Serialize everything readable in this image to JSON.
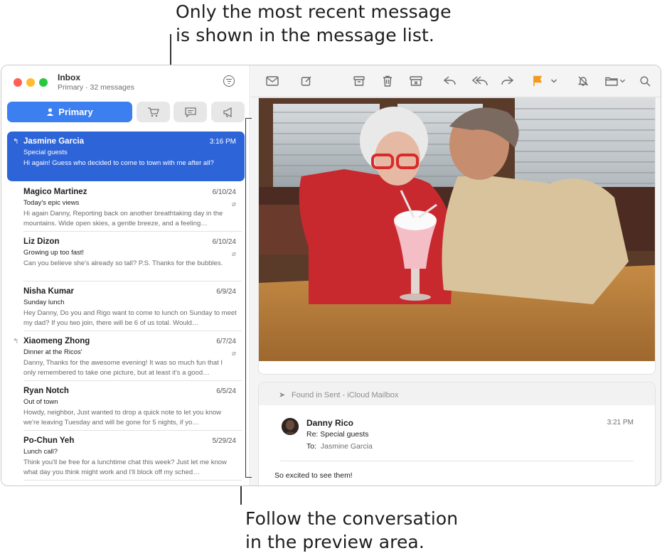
{
  "callouts": {
    "top": [
      "Only the most recent message",
      "is shown in the message list."
    ],
    "bottom": [
      "Follow the conversation",
      "in the preview area."
    ]
  },
  "sidebar": {
    "title": "Inbox",
    "subtitle": "Primary · 32 messages",
    "primary_tab": "Primary",
    "category_icons": [
      "cart-icon",
      "chat-bubble-icon",
      "megaphone-icon"
    ]
  },
  "messages": [
    {
      "from": "Jasmine Garcia",
      "date": "3:16 PM",
      "subject": "Special guests",
      "preview": "Hi again! Guess who decided to come to town with me after all?",
      "selected": true,
      "replied": true,
      "attachment": false
    },
    {
      "from": "Magico Martinez",
      "date": "6/10/24",
      "subject": "Today's epic views",
      "preview": "Hi again Danny, Reporting back on another breathtaking day in the mountains. Wide open skies, a gentle breeze, and a feeling…",
      "attachment": true
    },
    {
      "from": "Liz Dizon",
      "date": "6/10/24",
      "subject": "Growing up too fast!",
      "preview": "Can you believe she's already so tall? P.S. Thanks for the bubbles.",
      "attachment": true
    },
    {
      "from": "Nisha Kumar",
      "date": "6/9/24",
      "subject": "Sunday lunch",
      "preview": "Hey Danny, Do you and Rigo want to come to lunch on Sunday to meet my dad? If you two join, there will be 6 of us total. Would…",
      "attachment": false
    },
    {
      "from": "Xiaomeng Zhong",
      "date": "6/7/24",
      "subject": "Dinner at the Ricos'",
      "preview": "Danny, Thanks for the awesome evening! It was so much fun that I only remembered to take one picture, but at least it's a good…",
      "replied": true,
      "attachment": true
    },
    {
      "from": "Ryan Notch",
      "date": "6/5/24",
      "subject": "Out of town",
      "preview": "Howdy, neighbor, Just wanted to drop a quick note to let you know we're leaving Tuesday and will be gone for 5 nights, if yo…",
      "attachment": false
    },
    {
      "from": "Po-Chun Yeh",
      "date": "5/29/24",
      "subject": "Lunch call?",
      "preview": "Think you'll be free for a lunchtime chat this week? Just let me know what day you think might work and I'll block off my sched…",
      "attachment": false
    }
  ],
  "toolbar": {
    "icons": [
      "envelope-icon",
      "compose-icon",
      "archive-icon",
      "trash-icon",
      "junk-icon",
      "reply-icon",
      "reply-all-icon",
      "forward-icon",
      "flag-icon",
      "chevron-down-icon",
      "mute-icon",
      "folder-icon",
      "search-icon"
    ],
    "flag_color": "#f39a1f"
  },
  "thread": {
    "found_in": "Found in Sent - iCloud Mailbox",
    "from": "Danny Rico",
    "subject": "Re: Special guests",
    "to_label": "To:",
    "to": "Jasmine Garcia",
    "time": "3:21 PM",
    "body": "So excited to see them!"
  },
  "colors": {
    "accent": "#3c7ff0",
    "selection": "#2d64d8"
  }
}
